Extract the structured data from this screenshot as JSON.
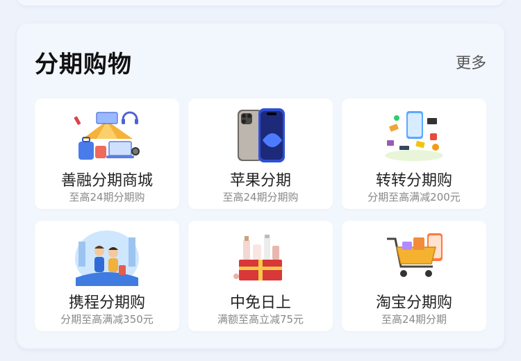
{
  "section": {
    "title": "分期购物",
    "more_label": "更多"
  },
  "tiles": [
    {
      "name": "善融分期商城",
      "sub": "至高24期分期购",
      "icon": "travel-shopping-icon"
    },
    {
      "name": "苹果分期",
      "sub": "至高24期分期购",
      "icon": "iphone-icon"
    },
    {
      "name": "转转分期购",
      "sub": "分期至高满减200元",
      "icon": "phone-gadgets-icon"
    },
    {
      "name": "携程分期购",
      "sub": "分期至高满减350元",
      "icon": "travelers-icon"
    },
    {
      "name": "中免日上",
      "sub": "满额至高立减75元",
      "icon": "cosmetics-gift-icon"
    },
    {
      "name": "淘宝分期购",
      "sub": "至高24期分期",
      "icon": "shopping-cart-icon"
    }
  ],
  "colors": {
    "page_bg": "#eef3fb",
    "card_bg": "#f2f6fd",
    "tile_bg": "#ffffff",
    "title": "#111111",
    "subtitle": "#888888"
  }
}
